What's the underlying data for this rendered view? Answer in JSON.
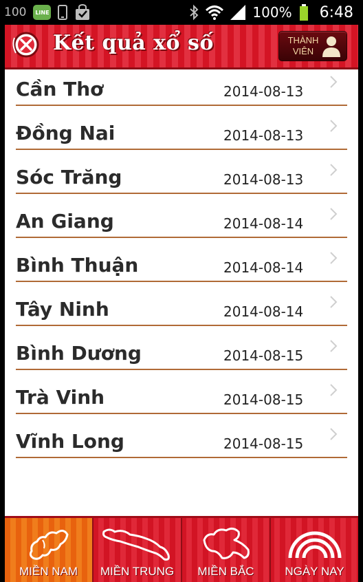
{
  "status_bar": {
    "notification_count": "100",
    "line_badge": "LINE",
    "battery_text": "100%",
    "time": "6:48"
  },
  "header": {
    "title": "Kết quả xổ số",
    "member_button_label": "THÀNH VIÊN"
  },
  "results": [
    {
      "province": "Cần Thơ",
      "date": "2014-08-13"
    },
    {
      "province": "Đồng Nai",
      "date": "2014-08-13"
    },
    {
      "province": "Sóc Trăng",
      "date": "2014-08-13"
    },
    {
      "province": "An Giang",
      "date": "2014-08-14"
    },
    {
      "province": "Bình Thuận",
      "date": "2014-08-14"
    },
    {
      "province": "Tây Ninh",
      "date": "2014-08-14"
    },
    {
      "province": "Bình Dương",
      "date": "2014-08-15"
    },
    {
      "province": "Trà Vinh",
      "date": "2014-08-15"
    },
    {
      "province": "Vĩnh Long",
      "date": "2014-08-15"
    }
  ],
  "bottom_nav": [
    {
      "label": "MIỀN NAM",
      "icon": "south-region-map-icon",
      "active": true
    },
    {
      "label": "MIỀN TRUNG",
      "icon": "central-region-map-icon",
      "active": false
    },
    {
      "label": "MIỀN BẮC",
      "icon": "north-region-map-icon",
      "active": false
    },
    {
      "label": "NGÀY NAY",
      "icon": "rainbow-icon",
      "active": false
    }
  ],
  "colors": {
    "header_red": "#d41424",
    "active_tab_orange": "#f07d1c",
    "divider_brown": "#b06a36",
    "member_button_gold": "#f3d9a6"
  }
}
